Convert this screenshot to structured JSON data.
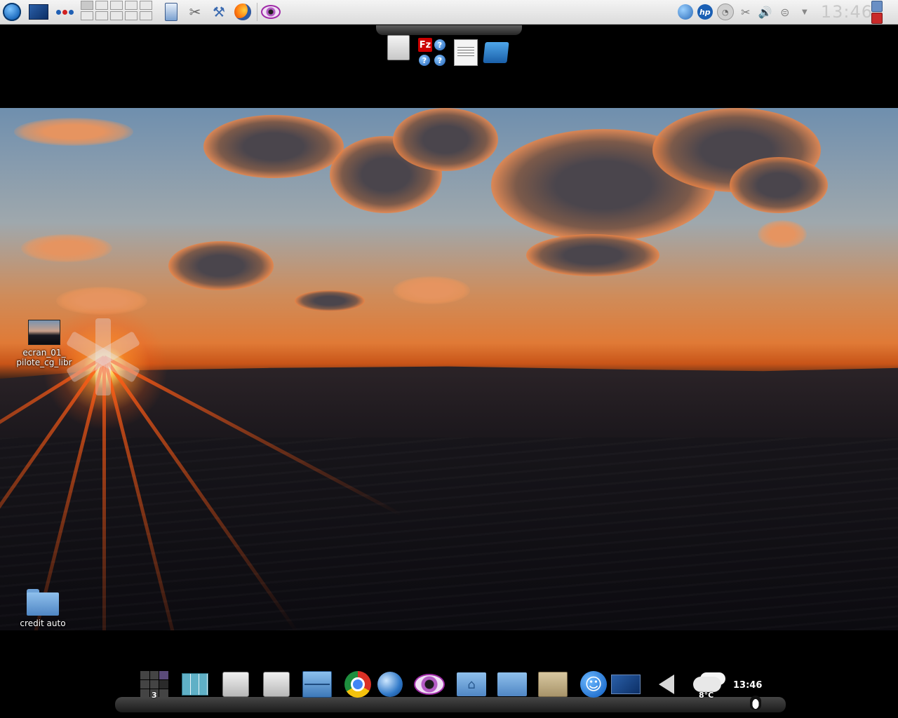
{
  "top_panel": {
    "workspaces": 10,
    "active_workspace": 1,
    "clock": "13:46",
    "launchers": [
      "menu-icon",
      "desktop-icon",
      "activity-dots-icon",
      "kfind-icon",
      "system-tools-icon",
      "network-icon",
      "firefox-icon",
      "eye-icon"
    ],
    "tray": [
      "globe-icon",
      "hp-icon",
      "speedometer-icon",
      "tools-icon",
      "volume-icon",
      "network-icon"
    ]
  },
  "top_dock": {
    "items": [
      "document-icon",
      "filezilla-icon",
      "help-icon",
      "text-editor-icon",
      "trash-icon"
    ],
    "fz_glyph": "Fz",
    "help_glyph": "?"
  },
  "desktop": {
    "icons": [
      {
        "label": "ecran_01_\npilote_cg_libr"
      },
      {
        "label": "credit  auto"
      }
    ]
  },
  "bottom_dock": {
    "pager_badge": "3",
    "weather": "8°C",
    "clock": "13:46"
  },
  "colors": {
    "panel": "#e6e6e6",
    "accent_blue": "#1f5fb4",
    "sunset_orange": "#e07a36"
  }
}
